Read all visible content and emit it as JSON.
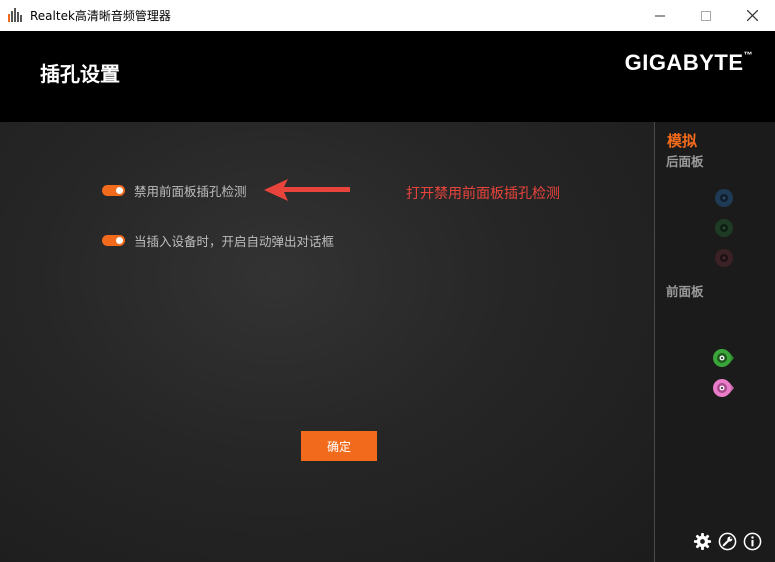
{
  "window": {
    "title": "Realtek高清晰音频管理器",
    "icons": [
      "app-icon",
      "minimize-icon",
      "maximize-icon",
      "close-icon"
    ]
  },
  "header": {
    "title": "插孔设置",
    "brand": "GIGABYTE",
    "brand_mark": "™"
  },
  "main": {
    "options": [
      {
        "label": "禁用前面板插孔检测",
        "enabled": true
      },
      {
        "label": "当插入设备时，开启自动弹出对话框",
        "enabled": true
      }
    ],
    "annotation": "打开禁用前面板插孔检测",
    "ok_label": "确定"
  },
  "sidebar": {
    "section": "模拟",
    "rear_label": "后面板",
    "front_label": "前面板",
    "rear_jacks": [
      "blue-jack-icon",
      "green-jack-icon",
      "pink-jack-icon"
    ],
    "front_jacks": [
      "green-jack-icon",
      "pink-jack-icon"
    ],
    "tools": [
      "gear-icon",
      "wrench-icon",
      "info-icon"
    ]
  },
  "colors": {
    "accent": "#f26b1d",
    "annotation": "#e8443c",
    "jack_green": "#3aa63a",
    "jack_pink": "#e87cc8",
    "jack_blue_dim": "#1e3a55"
  }
}
